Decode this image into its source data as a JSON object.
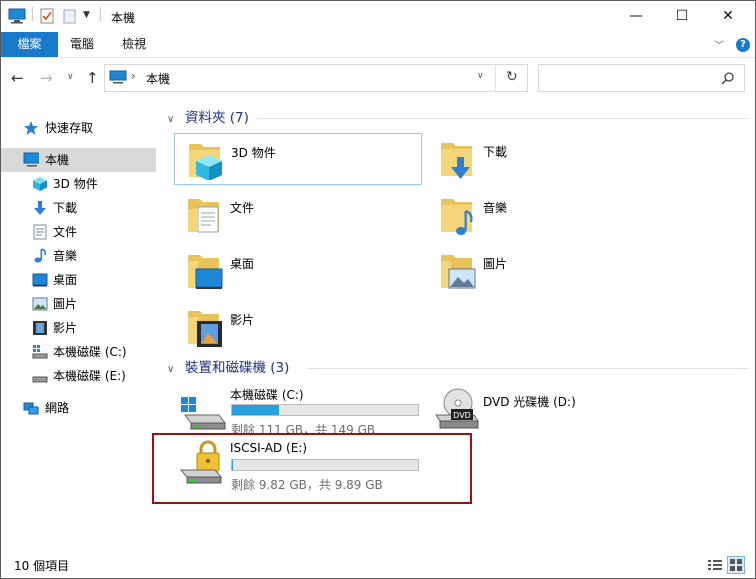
{
  "window": {
    "title": "本機",
    "caption": {
      "minimize": "—",
      "maximize": "☐",
      "close": "✕"
    }
  },
  "ribbon": {
    "tabs": [
      {
        "label": "檔案"
      },
      {
        "label": "電腦"
      },
      {
        "label": "檢視"
      }
    ],
    "help": "?"
  },
  "address": {
    "path": "本機",
    "separator": "›"
  },
  "search": {
    "placeholder": ""
  },
  "nav": {
    "quick_access": "快速存取",
    "this_pc": "本機",
    "items": [
      {
        "label": "3D 物件",
        "icon": "3d-objects-icon"
      },
      {
        "label": "下載",
        "icon": "downloads-icon"
      },
      {
        "label": "文件",
        "icon": "documents-icon"
      },
      {
        "label": "音樂",
        "icon": "music-icon"
      },
      {
        "label": "桌面",
        "icon": "desktop-icon"
      },
      {
        "label": "圖片",
        "icon": "pictures-icon"
      },
      {
        "label": "影片",
        "icon": "videos-icon"
      },
      {
        "label": "本機磁碟 (C:)",
        "icon": "drive-c-icon"
      },
      {
        "label": "本機磁碟 (E:)",
        "icon": "drive-e-icon"
      }
    ],
    "network": "網路"
  },
  "groups": {
    "folders": {
      "title": "資料夾 (7)"
    },
    "devices": {
      "title": "裝置和磁碟機 (3)"
    }
  },
  "folders": [
    {
      "label": "3D 物件",
      "icon": "3d-objects-folder-icon"
    },
    {
      "label": "下載",
      "icon": "downloads-folder-icon"
    },
    {
      "label": "文件",
      "icon": "documents-folder-icon"
    },
    {
      "label": "音樂",
      "icon": "music-folder-icon"
    },
    {
      "label": "桌面",
      "icon": "desktop-folder-icon"
    },
    {
      "label": "圖片",
      "icon": "pictures-folder-icon"
    },
    {
      "label": "影片",
      "icon": "videos-folder-icon"
    }
  ],
  "drives": [
    {
      "label": "本機磁碟 (C:)",
      "space": "剩餘 111 GB，共 149 GB",
      "used_fraction": 0.255
    },
    {
      "label": "DVD 光碟機 (D:)"
    },
    {
      "label": "ISCSI-AD (E:)",
      "space": "剩餘 9.82 GB，共 9.89 GB",
      "used_fraction": 0.007
    }
  ],
  "status": {
    "count": "10 個項目"
  },
  "colors": {
    "accent": "#1979ca",
    "bar_fill": "#26a0da",
    "highlight": "#a01010",
    "group_title": "#1e3287"
  }
}
